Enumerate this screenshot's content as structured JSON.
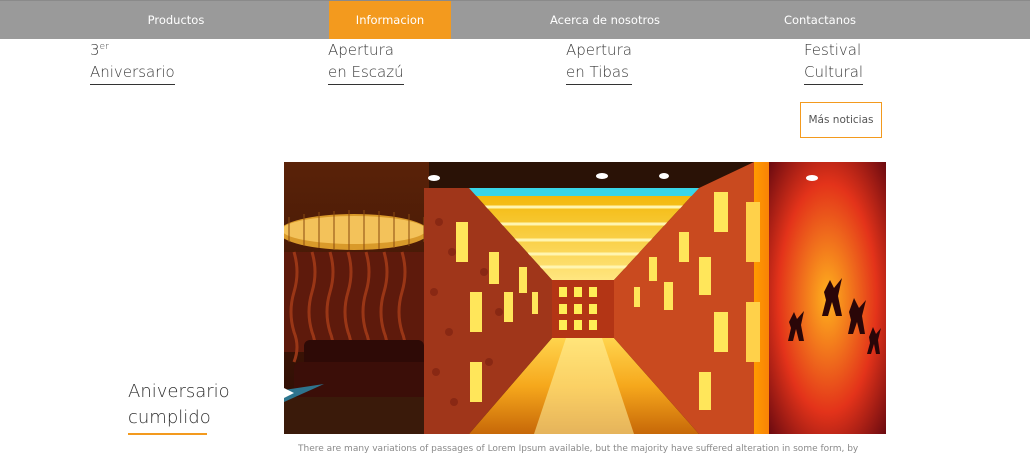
{
  "nav": {
    "items": [
      {
        "label": "Productos"
      },
      {
        "label": "Informacion",
        "active": true
      },
      {
        "label": "Acerca de nosotros"
      },
      {
        "label": "Contactanos"
      }
    ],
    "active_color": "#f39a1e",
    "bg_color": "#9a9a9a"
  },
  "news": [
    {
      "line1_main": "3",
      "line1_sup": "er",
      "line2": "Aniversario"
    },
    {
      "line1_main": "Apertura",
      "line2": "en Escazú"
    },
    {
      "line1_main": "Apertura",
      "line2": "en Tibas"
    },
    {
      "line1_main": "Festival",
      "line2": "Cultural"
    }
  ],
  "more_button": {
    "label": "Más noticias"
  },
  "featured": {
    "title_line1": "Aniversario",
    "title_line2": "cumplido",
    "excerpt": "There are many variations of passages of Lorem Ipsum available, but the majority have suffered alteration in some form, by"
  }
}
